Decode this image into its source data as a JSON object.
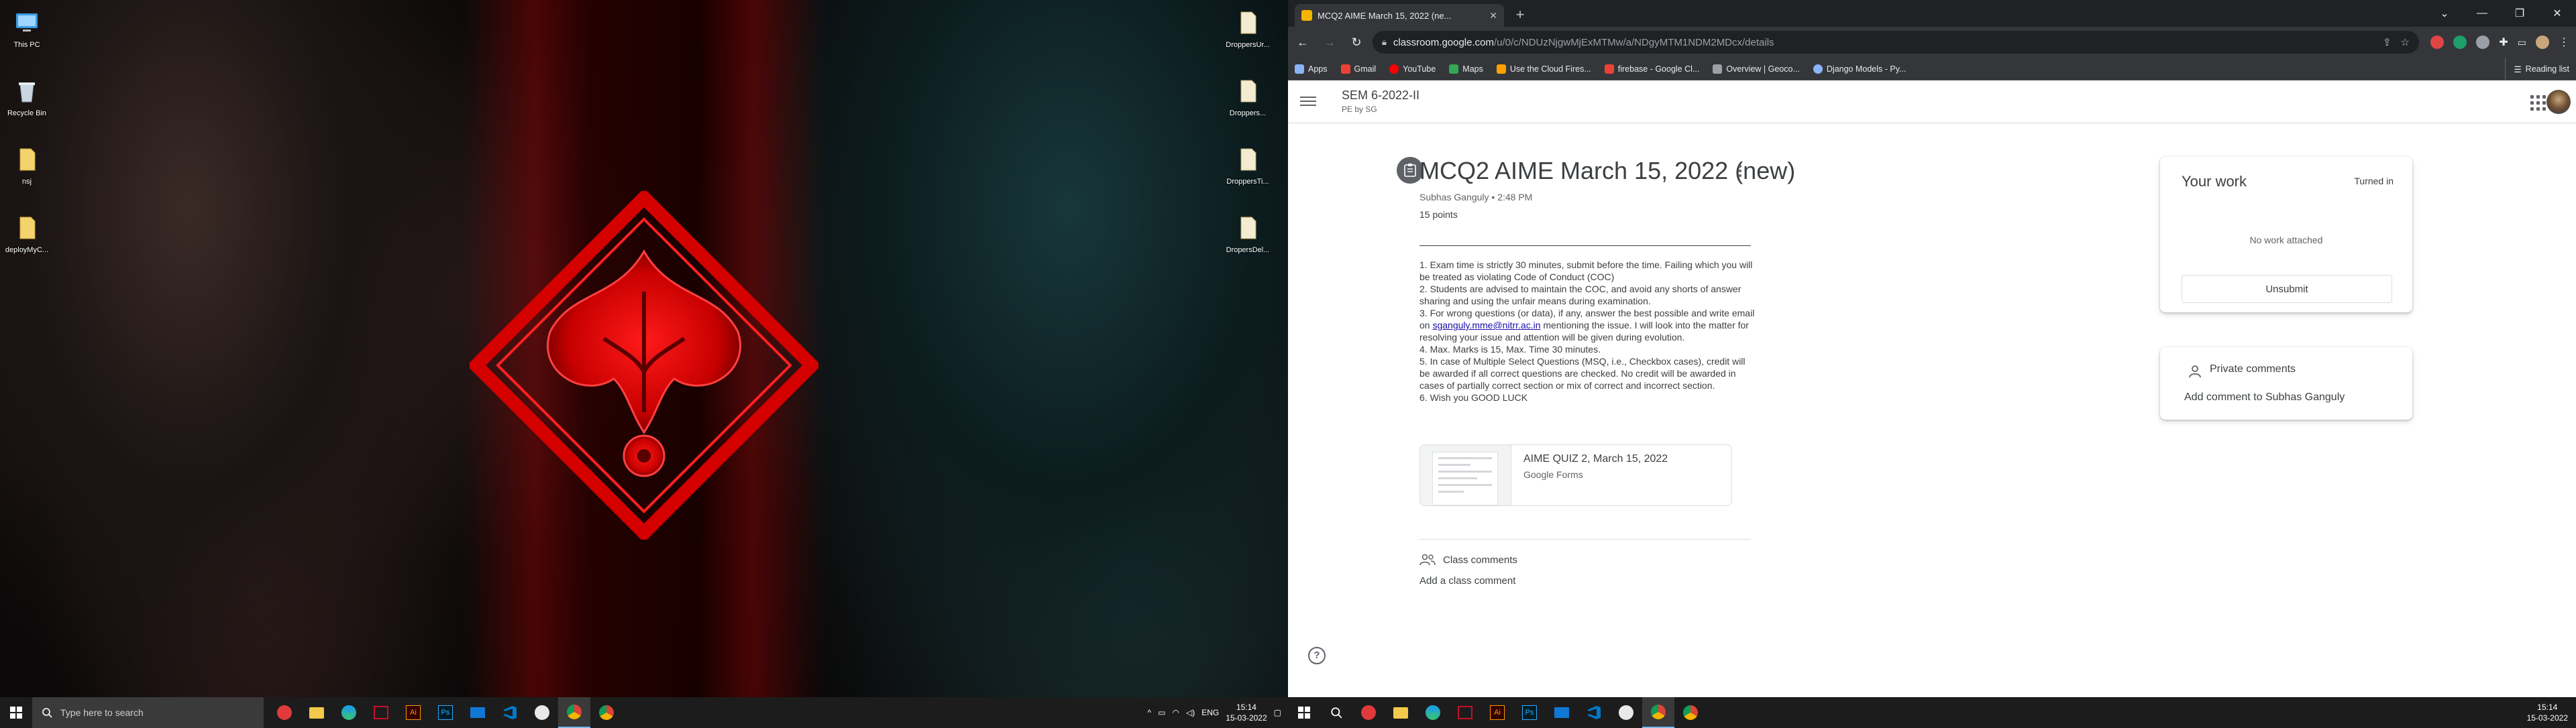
{
  "left_monitor": {
    "desktop_icons_left": [
      {
        "label": "This PC",
        "icon": "monitor-icon"
      },
      {
        "label": "Recycle Bin",
        "icon": "recycle-bin-icon"
      },
      {
        "label": "nsj",
        "icon": "file-icon"
      },
      {
        "label": "deployMyC...",
        "icon": "file-icon"
      }
    ],
    "desktop_icons_right": [
      {
        "label": "DroppersUr...",
        "icon": "file-icon"
      },
      {
        "label": "Droppers...",
        "icon": "file-icon"
      },
      {
        "label": "DroppersTi...",
        "icon": "file-icon"
      },
      {
        "label": "DropersDel...",
        "icon": "file-icon"
      }
    ],
    "taskbar": {
      "search_placeholder": "Type here to search",
      "apps": [
        "red-app-icon",
        "file-explorer-icon",
        "edge-icon",
        "hp-icon",
        "illustrator-icon",
        "photoshop-icon",
        "mail-icon",
        "vscode-icon",
        "steam-icon",
        "chrome-icon",
        "chrome-canary-icon"
      ],
      "tray_lang": "ENG",
      "time": "15:14",
      "date": "15-03-2022"
    }
  },
  "browser": {
    "tab_title": "MCQ2 AIME March 15, 2022 (ne...",
    "url_domain": "classroom.google.com",
    "url_path": "/u/0/c/NDUzNjgwMjExMTMw/a/NDgyMTM1NDM2MDcx/details",
    "bookmarks": [
      {
        "label": "Apps",
        "color": "#8ab4f8"
      },
      {
        "label": "Gmail",
        "color": "#ea4335"
      },
      {
        "label": "YouTube",
        "color": "#ff0000"
      },
      {
        "label": "Maps",
        "color": "#34a853"
      },
      {
        "label": "Use the Cloud Fires...",
        "color": "#ffa000"
      },
      {
        "label": "firebase - Google Cl...",
        "color": "#ea4335"
      },
      {
        "label": "Overview | Geoco...",
        "color": "#9aa0a6"
      },
      {
        "label": "Django Models - Py...",
        "color": "#8ab4f8"
      }
    ],
    "reading_list": "Reading list"
  },
  "classroom": {
    "class_name": "SEM 6-2022-II",
    "class_subtitle": "PE by SG",
    "assignment": {
      "title": "MCQ2 AIME March 15, 2022 (new)",
      "meta": "Subhas Ganguly • 2:48 PM",
      "points": "15 points",
      "instructions": [
        "1. Exam time is strictly 30 minutes, submit before the time. Failing which you will be treated as violating Code of Conduct (COC)",
        "2. Students are advised to maintain the COC, and avoid any shorts of answer sharing and using the unfair means during examination.",
        "4. Max. Marks is 15,  Max. Time 30 minutes.",
        "5. In case of Multiple Select Questions (MSQ, i.e.,  Checkbox cases), credit will be awarded if all correct questions are checked. No credit will be awarded in cases of partially correct section or mix of correct and incorrect section.",
        "6. Wish you GOOD LUCK"
      ],
      "instruction3_prefix": "3. For wrong questions (or data), if any, answer the best possible and write email on ",
      "instruction3_email": "sganguly.mme@nitrr.ac.in",
      "instruction3_suffix": " mentioning the issue. I will look into the matter for resolving your issue and attention will be given during evolution.",
      "attachment": {
        "name": "AIME QUIZ 2, March 15, 2022",
        "type": "Google Forms"
      },
      "class_comments_label": "Class comments",
      "add_class_comment": "Add a class comment"
    },
    "your_work": {
      "title": "Your work",
      "status": "Turned in",
      "empty_text": "No work attached",
      "unsubmit_label": "Unsubmit"
    },
    "private_comments": {
      "title": "Private comments",
      "add_label": "Add comment to Subhas Ganguly"
    },
    "help_glyph": "?"
  },
  "right_taskbar": {
    "apps": [
      "start-icon",
      "search-icon",
      "red-app-icon",
      "file-explorer-icon",
      "edge-icon",
      "hp-icon",
      "illustrator-icon",
      "photoshop-icon",
      "mail-icon",
      "vscode-icon",
      "steam-icon",
      "chrome-icon",
      "chrome-canary-icon"
    ],
    "time": "15:14",
    "date": "15-03-2022"
  }
}
